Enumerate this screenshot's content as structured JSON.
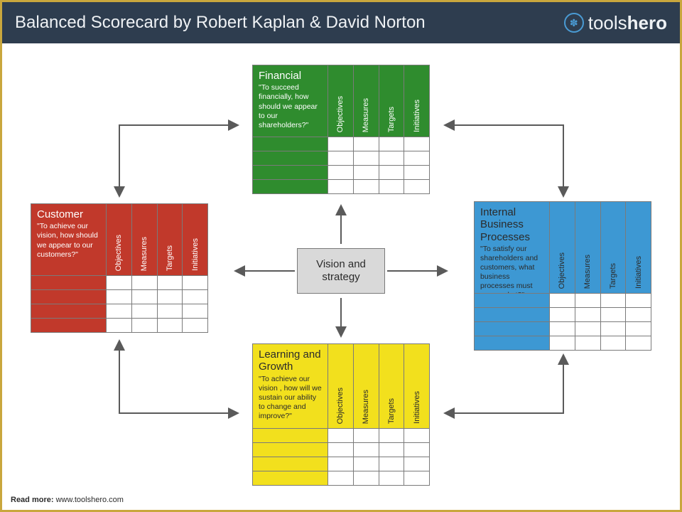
{
  "header": {
    "title": "Balanced Scorecard by Robert Kaplan & David Norton",
    "brand_light": "tools",
    "brand_bold": "hero"
  },
  "center": {
    "label": "Vision and strategy"
  },
  "columns": [
    "Objectives",
    "Measures",
    "Targets",
    "Initiatives"
  ],
  "cards": {
    "financial": {
      "title": "Financial",
      "quote": "\"To succeed financially, how should we appear to our shareholders?\""
    },
    "customer": {
      "title": "Customer",
      "quote": "\"To achieve our vision, how should we appear to our customers?\""
    },
    "internal": {
      "title": "Internal Business Processes",
      "quote": "\"To satisfy our shareholders and customers, what business processes must we excel at?\""
    },
    "learning": {
      "title": "Learning and Growth",
      "quote": "\"To achieve our vision , how will we sustain our ability to change and improve?\""
    }
  },
  "footer": {
    "label": "Read more:",
    "url": "www.toolshero.com"
  }
}
